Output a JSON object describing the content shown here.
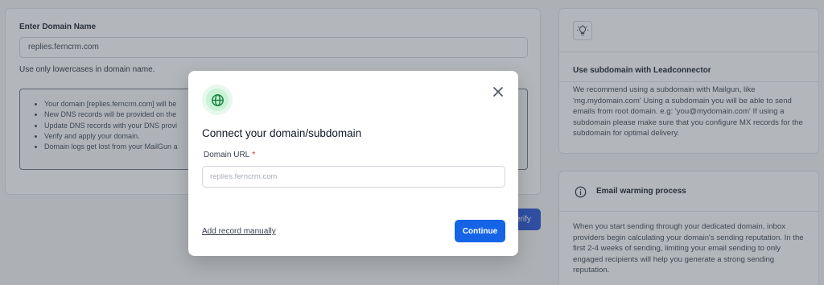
{
  "background": {
    "domain_form": {
      "label": "Enter Domain Name",
      "value": "replies.ferncrm.com",
      "hint": "Use only lowercases in domain name.",
      "info_items": [
        "Your domain [replies.ferncrm.com] will be",
        "New DNS records will be provided on the",
        "Update DNS records with your DNS provi",
        "Verify and apply your domain.",
        "Domain logs get lost from your MailGun a"
      ]
    },
    "verify_button": "erify",
    "subdomain_card": {
      "icon": "lightbulb-icon",
      "title": "Use subdomain with Leadconnector",
      "body": "We recommend using a subdomain with Mailgun, like 'mg.mydomain.com' Using a subdomain you will be able to send emails from root domain. e.g: 'you@mydomain.com' If using a subdomain please make sure that you configure MX records for the subdomain for optimal delivery."
    },
    "warming_card": {
      "icon": "info-circle-icon",
      "title": "Email warming process",
      "body": "When you start sending through your dedicated domain, inbox providers begin calculating your domain's sending reputation. In the first 2-4 weeks of sending, limiting your email sending to only engaged recipients will help you generate a strong sending reputation."
    }
  },
  "modal": {
    "icon": "globe-icon",
    "title": "Connect your domain/subdomain",
    "field_label": "Domain URL",
    "required_mark": "*",
    "input_placeholder": "replies.ferncrm.com",
    "add_record_link": "Add record manually",
    "continue_button": "Continue"
  },
  "colors": {
    "primary": "#1564e6",
    "required": "#dc2626",
    "globe_green": "#16a34a"
  }
}
